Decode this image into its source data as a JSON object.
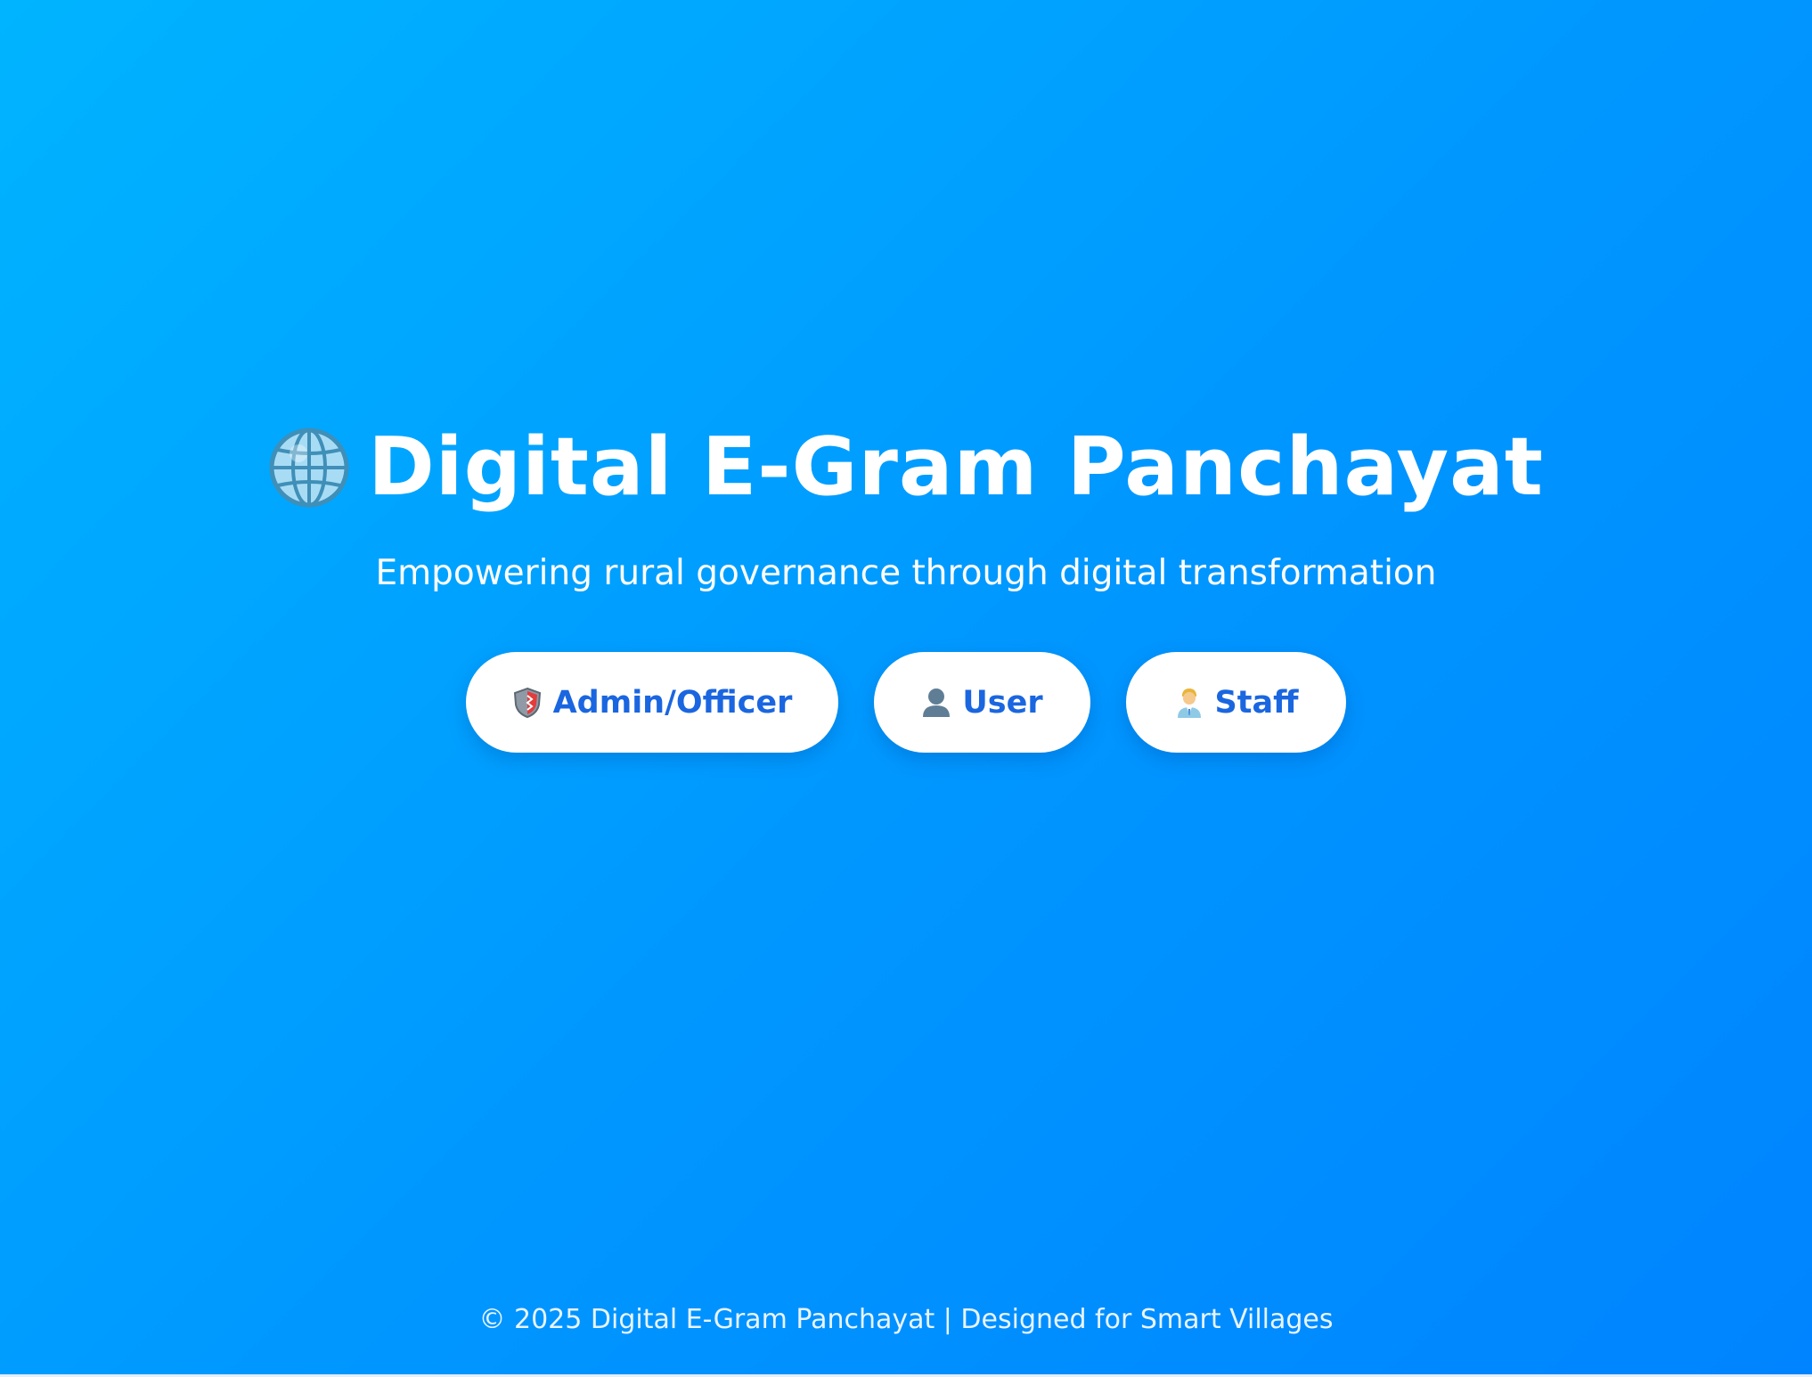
{
  "hero": {
    "title": "Digital E-Gram Panchayat",
    "title_icon": "globe-icon",
    "subtitle": "Empowering rural governance through digital transformation"
  },
  "roles": [
    {
      "label": "Admin/Officer",
      "icon": "shield-icon"
    },
    {
      "label": "User",
      "icon": "user-silhouette-icon"
    },
    {
      "label": "Staff",
      "icon": "staff-person-icon"
    }
  ],
  "footer": {
    "text": "© 2025 Digital E-Gram Panchayat | Designed for Smart Villages"
  },
  "colors": {
    "background_start": "#00b4ff",
    "background_end": "#0084ff",
    "button_text": "#1a66e0",
    "button_background": "#ffffff"
  }
}
